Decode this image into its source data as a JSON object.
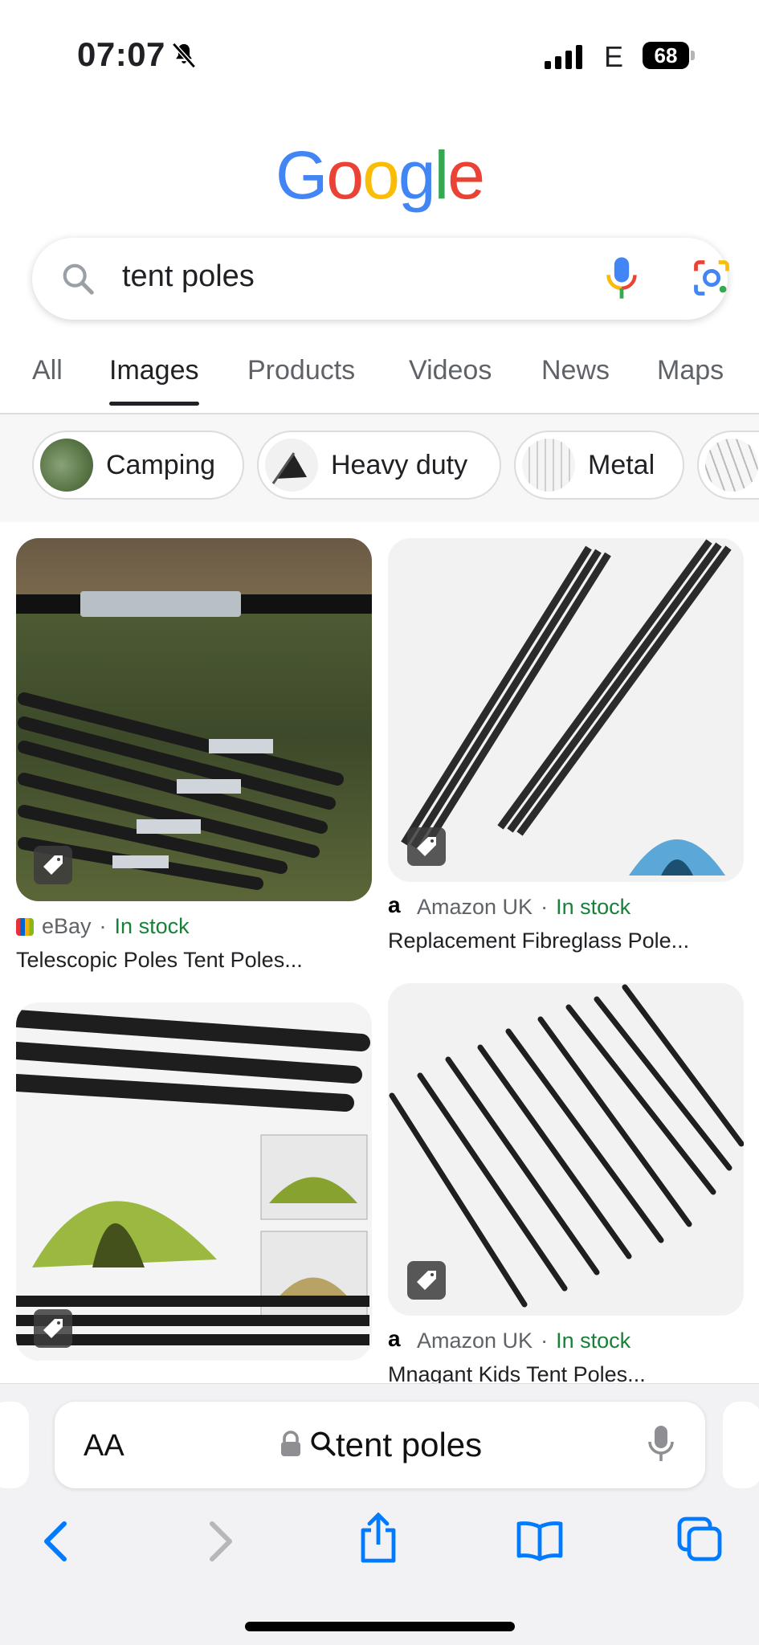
{
  "status_bar": {
    "time": "07:07",
    "network": "E",
    "battery": "68"
  },
  "logo": [
    "G",
    "o",
    "o",
    "g",
    "l",
    "e"
  ],
  "logo_colors": [
    "#4285F4",
    "#EA4335",
    "#FBBC05",
    "#4285F4",
    "#34A853",
    "#EA4335"
  ],
  "search": {
    "query": "tent poles"
  },
  "tabs": [
    {
      "label": "All"
    },
    {
      "label": "Images"
    },
    {
      "label": "Products"
    },
    {
      "label": "Videos"
    },
    {
      "label": "News"
    },
    {
      "label": "Maps"
    }
  ],
  "active_tab": "Images",
  "chips": [
    {
      "label": "Camping"
    },
    {
      "label": "Heavy duty"
    },
    {
      "label": "Metal"
    }
  ],
  "results": [
    {
      "source": "eBay",
      "availability": "In stock",
      "title": "Telescopic Poles Tent Poles..."
    },
    {
      "source": "Amazon UK",
      "availability": "In stock",
      "title": "Replacement Fibreglass Pole..."
    },
    {
      "source": "Amazon UK",
      "availability": "In stock",
      "title": "Mnagant Kids Tent Poles..."
    }
  ],
  "browser": {
    "text_size_label": "AA",
    "address_text": "tent poles"
  },
  "colors": {
    "in_stock": "#188038",
    "tab_active": "#202124",
    "ios_blue": "#007AFF"
  }
}
